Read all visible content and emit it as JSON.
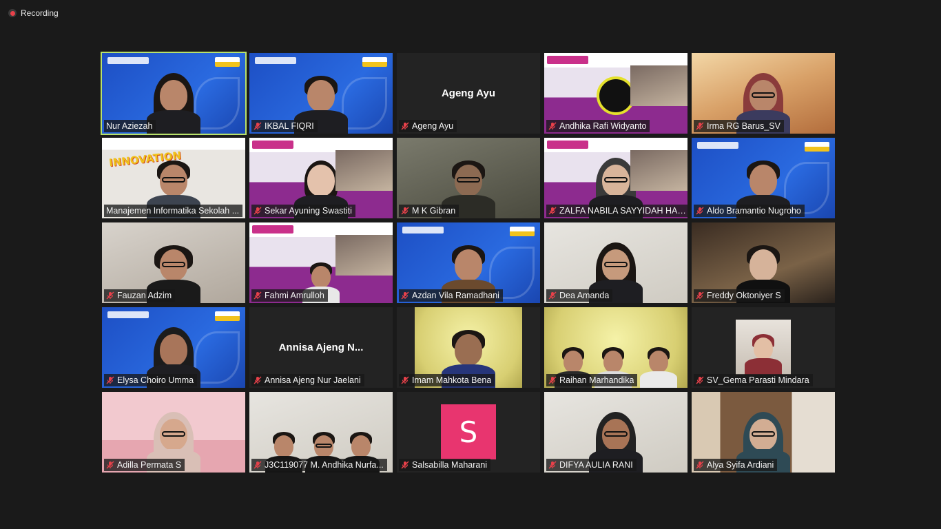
{
  "recording": {
    "label": "Recording"
  },
  "colors": {
    "active_border": "#b9e26a",
    "mute_icon": "#e8414a",
    "avatar_bg": "#e8356f"
  },
  "participants": [
    {
      "name": "Nur Aziezah",
      "muted": false,
      "active": true
    },
    {
      "name": "IKBAL FIQRI",
      "muted": true
    },
    {
      "name": "Ageng Ayu",
      "muted": true,
      "video_off": true,
      "display_name": "Ageng Ayu"
    },
    {
      "name": "Andhika Rafi Widyanto",
      "muted": true
    },
    {
      "name": "Irma RG Barus_SV",
      "muted": true
    },
    {
      "name": "Manajemen Informatika Sekolah ...",
      "muted": false
    },
    {
      "name": "Sekar Ayuning Swastiti",
      "muted": true
    },
    {
      "name": "M K Gibran",
      "muted": true
    },
    {
      "name": "ZALFA NABILA SAYYIDAH HAS...",
      "muted": true
    },
    {
      "name": "Aldo Bramantio Nugroho",
      "muted": true
    },
    {
      "name": "Fauzan Adzim",
      "muted": true
    },
    {
      "name": "Fahmi Amrulloh",
      "muted": true
    },
    {
      "name": "Azdan Vila Ramadhani",
      "muted": true
    },
    {
      "name": "Dea Amanda",
      "muted": true
    },
    {
      "name": "Freddy Oktoniyer S",
      "muted": true
    },
    {
      "name": "Elysa Choiro Umma",
      "muted": true
    },
    {
      "name": "Annisa Ajeng Nur Jaelani",
      "muted": true,
      "video_off": true,
      "display_name": "Annisa Ajeng N..."
    },
    {
      "name": "Imam Mahkota Bena",
      "muted": true
    },
    {
      "name": "Raihan Marhandika",
      "muted": true
    },
    {
      "name": "SV_Gema Parasti Mindara",
      "muted": true
    },
    {
      "name": "Adilla Permata S",
      "muted": true
    },
    {
      "name": "J3C119077 M. Andhika Nurfa...",
      "muted": true
    },
    {
      "name": "Salsabilla Maharani",
      "muted": true,
      "video_off": true,
      "avatar_letter": "S"
    },
    {
      "name": "DIFYA AULIA RANI",
      "muted": true
    },
    {
      "name": "Alya Syifa Ardiani",
      "muted": true
    }
  ]
}
